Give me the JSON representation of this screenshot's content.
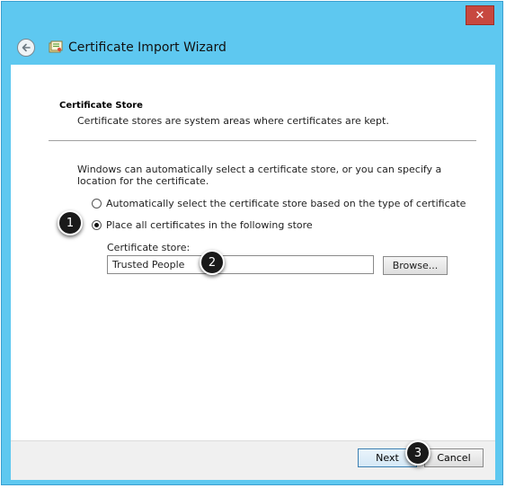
{
  "window": {
    "title": "Certificate Import Wizard",
    "close_glyph": "✕"
  },
  "section": {
    "title": "Certificate Store",
    "description": "Certificate stores are system areas where certificates are kept."
  },
  "intro_text": "Windows can automatically select a certificate store, or you can specify a location for the certificate.",
  "options": {
    "auto": {
      "label": "Automatically select the certificate store based on the type of certificate",
      "checked": false
    },
    "manual": {
      "label": "Place all certificates in the following store",
      "checked": true
    }
  },
  "store": {
    "label": "Certificate store:",
    "value": "Trusted People",
    "browse_label": "Browse..."
  },
  "buttons": {
    "next": "Next",
    "cancel": "Cancel"
  },
  "callouts": [
    "1",
    "2",
    "3"
  ],
  "colors": {
    "titlebar": "#5ec8f0",
    "close": "#c7483f",
    "callout": "#1a1a1a"
  },
  "icons": {
    "back": "back-arrow-icon",
    "wizard": "certificate-wizard-icon",
    "close": "close-icon"
  }
}
